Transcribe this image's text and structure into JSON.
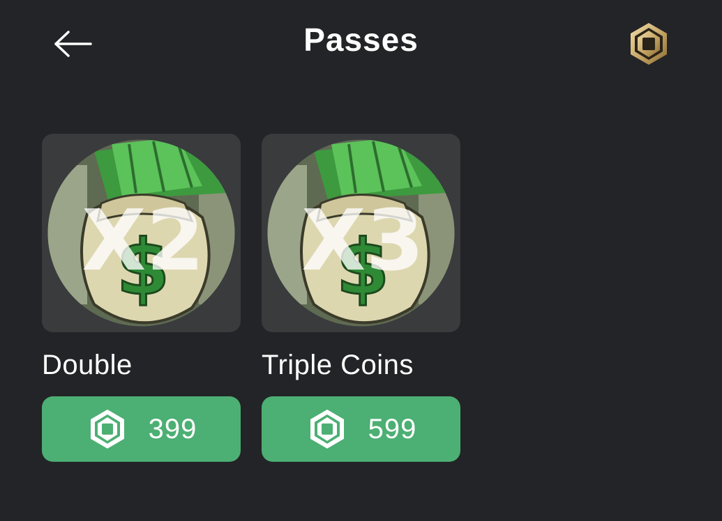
{
  "header": {
    "title": "Passes",
    "back_icon": "arrow-left-icon",
    "balance_icon": "robux-icon"
  },
  "passes": [
    {
      "name": "Double",
      "price": "399",
      "overlay_text": "X2",
      "image_icon": "money-bag-icon"
    },
    {
      "name": "Triple Coins",
      "price": "599",
      "overlay_text": "X3",
      "image_icon": "money-bag-icon"
    }
  ],
  "colors": {
    "background": "#232427",
    "card_bg": "#393b3d",
    "buy_button": "#4caf73",
    "gold_icon": "#c9a96a"
  }
}
